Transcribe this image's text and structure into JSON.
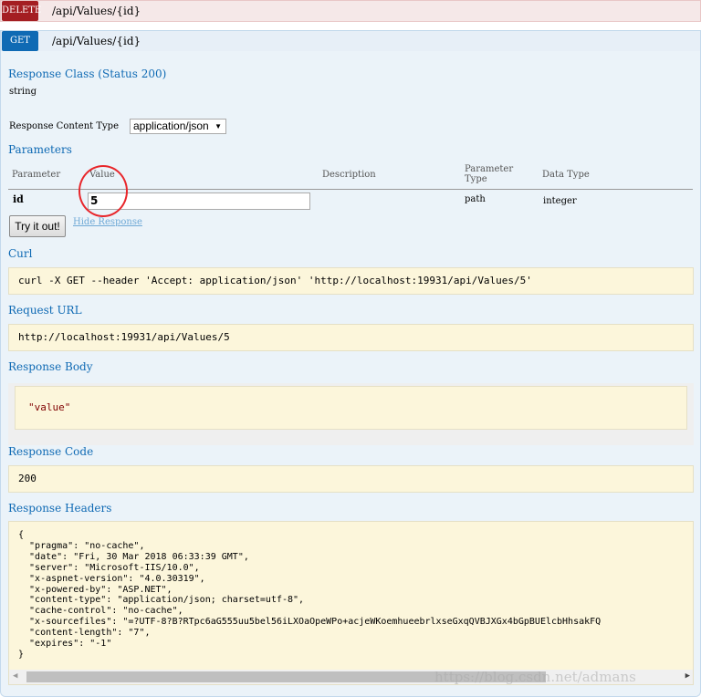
{
  "delete_op": {
    "method": "DELETE",
    "path": "/api/Values/{id}"
  },
  "get_op": {
    "method": "GET",
    "path": "/api/Values/{id}"
  },
  "response_class": {
    "heading": "Response Class (Status 200)",
    "type": "string"
  },
  "content_type": {
    "label": "Response Content Type",
    "selected": "application/json"
  },
  "parameters": {
    "heading": "Parameters",
    "columns": [
      "Parameter",
      "Value",
      "Description",
      "Parameter Type",
      "Data Type"
    ],
    "rows": [
      {
        "name": "id",
        "value": "5",
        "description": "",
        "param_type": "path",
        "data_type": "integer"
      }
    ]
  },
  "actions": {
    "try_label": "Try it out!",
    "hide_label": "Hide Response"
  },
  "curl": {
    "heading": "Curl",
    "command": "curl -X GET --header 'Accept: application/json' 'http://localhost:19931/api/Values/5'"
  },
  "request_url": {
    "heading": "Request URL",
    "url": "http://localhost:19931/api/Values/5"
  },
  "response_body": {
    "heading": "Response Body",
    "value": "\"value\""
  },
  "response_code": {
    "heading": "Response Code",
    "value": "200"
  },
  "response_headers": {
    "heading": "Response Headers",
    "text": "{\n  \"pragma\": \"no-cache\",\n  \"date\": \"Fri, 30 Mar 2018 06:33:39 GMT\",\n  \"server\": \"Microsoft-IIS/10.0\",\n  \"x-aspnet-version\": \"4.0.30319\",\n  \"x-powered-by\": \"ASP.NET\",\n  \"content-type\": \"application/json; charset=utf-8\",\n  \"cache-control\": \"no-cache\",\n  \"x-sourcefiles\": \"=?UTF-8?B?RTpc6aG555uu5bel56iLXOaOpeWPo+acjeWKoemhueebrlxseGxqQVBJXGx4bGpBUElcbHhsakFQ\n  \"content-length\": \"7\",\n  \"expires\": \"-1\"\n}"
  },
  "watermark": "https://blog.csdn.net/admans"
}
